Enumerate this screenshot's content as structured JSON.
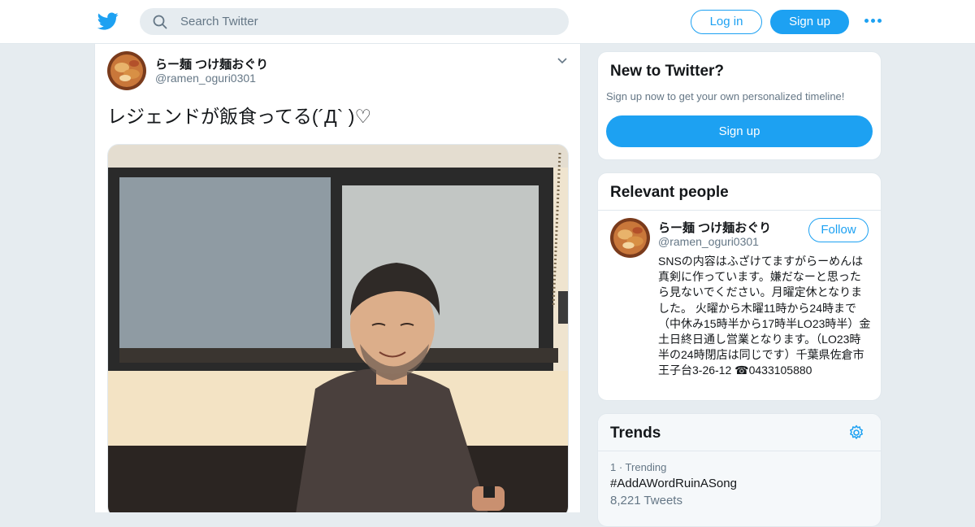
{
  "topbar": {
    "search_placeholder": "Search Twitter",
    "login_label": "Log in",
    "signup_label": "Sign up",
    "brand_color": "#1da1f2"
  },
  "tweet": {
    "name": "らー麺 つけ麺おぐり",
    "handle": "@ramen_oguri0301",
    "text": "レジェンドが飯食ってる(´Д` )♡"
  },
  "new_to_twitter": {
    "title": "New to Twitter?",
    "subtitle": "Sign up now to get your own personalized timeline!",
    "button": "Sign up"
  },
  "relevant_people": {
    "title": "Relevant people",
    "name": "らー麺 つけ麺おぐり",
    "handle": "@ramen_oguri0301",
    "follow": "Follow",
    "bio": "SNSの内容はふざけてますがらーめんは真剣に作っています。嫌だなーと思ったら見ないでください。月曜定休となりました。 火曜から木曜11時から24時まで（中休み15時半から17時半LO23時半）金土日終日通し営業となります。（LO23時半の24時閉店は同じです）千葉県佐倉市王子台3-26-12 ☎0433105880"
  },
  "trends": {
    "title": "Trends",
    "items": [
      {
        "rank_label": "1 · Trending",
        "tag": "#AddAWordRuinASong",
        "count": "8,221 Tweets"
      }
    ]
  }
}
